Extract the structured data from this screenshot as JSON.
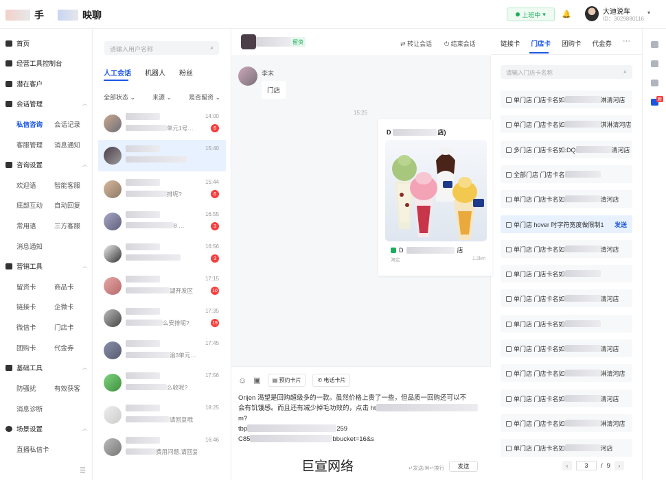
{
  "app": {
    "logo_text_1": "手",
    "logo_text_2": "映聊"
  },
  "header": {
    "status_label": "上班中",
    "user_name": "大迪说车",
    "user_id": "ID：3029880116"
  },
  "nav": {
    "items": [
      {
        "label": "首页",
        "icon": "home-icon"
      },
      {
        "label": "经营工具控制台",
        "icon": "dashboard-icon"
      },
      {
        "label": "潜在客户",
        "icon": "users-icon"
      },
      {
        "label": "会话管理",
        "icon": "chat-icon"
      },
      {
        "label": "咨询设置",
        "icon": "headset-icon"
      },
      {
        "label": "营销工具",
        "icon": "folder-icon"
      },
      {
        "label": "基础工具",
        "icon": "toolbox-icon"
      },
      {
        "label": "场景设置",
        "icon": "settings-icon"
      }
    ],
    "session": [
      "私信咨询",
      "会话记录",
      "客服管理",
      "消息通知"
    ],
    "consult": [
      "欢迎语",
      "智能客服",
      "底部互动",
      "自动回复",
      "常用语",
      "三方客服",
      "消息通知"
    ],
    "marketing": [
      "留资卡",
      "商品卡",
      "链接卡",
      "企微卡",
      "微信卡",
      "门店卡",
      "团购卡",
      "代金券"
    ],
    "basic": [
      "防骚扰",
      "有效获客",
      "消息诊断"
    ],
    "scene": [
      "直播私信卡"
    ]
  },
  "conversations": {
    "search_placeholder": "请输入用户名称",
    "tabs": [
      "人工会话",
      "机器人",
      "粉丝"
    ],
    "filters": [
      "全部状态",
      "来源",
      "是否留资"
    ],
    "items": [
      {
        "time": "14:00",
        "msg": "单元1号…",
        "badge": "6"
      },
      {
        "time": "15:40",
        "msg": "",
        "badge": ""
      },
      {
        "time": "15:44",
        "msg": "排呢?",
        "badge": "6"
      },
      {
        "time": "16:55",
        "msg": "8 …",
        "badge": "3"
      },
      {
        "time": "16:56",
        "msg": "",
        "badge": "3"
      },
      {
        "time": "17:15",
        "msg": "湖开发区",
        "badge": "10"
      },
      {
        "time": "17:35",
        "msg": "么安排呢?",
        "badge": "19"
      },
      {
        "time": "17:45",
        "msg": "渝3单元…",
        "badge": ""
      },
      {
        "time": "17:56",
        "msg": "么收呢?",
        "badge": ""
      },
      {
        "time": "18:25",
        "msg": "请回复哦",
        "badge": ""
      },
      {
        "time": "16:46",
        "msg": "费用问题,请回复哦",
        "badge": ""
      }
    ]
  },
  "chat": {
    "header_tag": "留资",
    "transfer_label": "转让会话",
    "end_label": "结束会话",
    "sender_name": "李末",
    "message": "门店",
    "time_divider": "15:25",
    "card": {
      "title_prefix": "D",
      "title_suffix": "店)",
      "loc_prefix": "D",
      "loc_suffix": "店",
      "sub": "海定",
      "distance": "1.2km"
    },
    "composer": {
      "appointment_card": "预约卡片",
      "phone_card": "电话卡片",
      "line1": "Orijen 渴望是回购超级多的一款。虽然价格上贵了一些，但品质一回购还可以不",
      "line2": "会有饥饿感。而且还有减少掉毛功效的，点击 ht",
      "line2_end": "m?",
      "line3_start": "tbp",
      "line3_end": "259",
      "line4_start": "C85",
      "line4_end": "bbucket=16&s",
      "watermark": "巨宣网络",
      "hint": "↵发送/⌘↵换行",
      "send": "发送"
    }
  },
  "store_panel": {
    "tabs": [
      "链接卡",
      "门店卡",
      "团购卡",
      "代金券"
    ],
    "more": "···",
    "search_placeholder": "请输入门店卡名称",
    "items": [
      {
        "text": "单门店 门店卡名如",
        "tail": "淋清河店",
        "hover": false
      },
      {
        "text": "单门店 门店卡名如",
        "tail": "淇淋清河店",
        "hover": false
      },
      {
        "text": "多门店 门店卡名如:DQ",
        "tail": "清河店",
        "hover": false
      },
      {
        "text": "全部门店 门店卡名",
        "tail": "",
        "hover": false
      },
      {
        "text": "单门店 门店卡名如",
        "tail": "清河店",
        "hover": false
      },
      {
        "text": "单门店 hover 时字符宽度做限制1",
        "tail": "",
        "hover": true
      },
      {
        "text": "单门店 门店卡名如",
        "tail": "清河店",
        "hover": false
      },
      {
        "text": "单门店 门店卡名如",
        "tail": "",
        "hover": false
      },
      {
        "text": "单门店 门店卡名如",
        "tail": "清河店",
        "hover": false
      },
      {
        "text": "单门店 门店卡名如",
        "tail": "",
        "hover": false
      },
      {
        "text": "单门店 门店卡名如",
        "tail": "清河店",
        "hover": false
      },
      {
        "text": "单门店 门店卡名如",
        "tail": "淋清河店",
        "hover": false
      },
      {
        "text": "单门店 门店卡名如",
        "tail": "清河店",
        "hover": false
      },
      {
        "text": "单门店 门店卡名如",
        "tail": "淋清河店",
        "hover": false
      },
      {
        "text": "单门店 门店卡名如",
        "tail": "河店",
        "hover": false
      }
    ],
    "send_label": "发送",
    "page_current": "3",
    "page_sep": "/",
    "page_total": "9"
  },
  "rail": {
    "badge": "新"
  }
}
